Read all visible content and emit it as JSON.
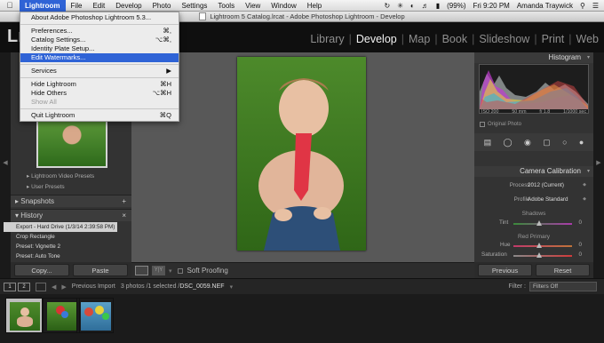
{
  "menubar": {
    "apple": "",
    "items": [
      "Lightroom",
      "File",
      "Edit",
      "Develop",
      "Photo",
      "Settings",
      "Tools",
      "View",
      "Window",
      "Help"
    ],
    "status": {
      "battery": "(99%)",
      "clock": "Fri 9:20 PM",
      "user": "Amanda Traywick"
    }
  },
  "window": {
    "title": "Lightroom 5 Catalog.lrcat - Adobe Photoshop Lightroom - Develop"
  },
  "app": {
    "logo": "Lr",
    "modules": [
      "Library",
      "Develop",
      "Map",
      "Book",
      "Slideshow",
      "Print",
      "Web"
    ],
    "active_module": "Develop"
  },
  "dropdown": {
    "items": [
      {
        "label": "About Adobe Photoshop Lightroom 5.3...",
        "shortcut": ""
      },
      {
        "sep": true
      },
      {
        "label": "Preferences...",
        "shortcut": "⌘,"
      },
      {
        "label": "Catalog Settings...",
        "shortcut": "⌥⌘,"
      },
      {
        "label": "Identity Plate Setup...",
        "shortcut": ""
      },
      {
        "label": "Edit Watermarks...",
        "shortcut": "",
        "highlighted": true
      },
      {
        "sep": true
      },
      {
        "label": "Services",
        "shortcut": "▶"
      },
      {
        "sep": true
      },
      {
        "label": "Hide Lightroom",
        "shortcut": "⌘H"
      },
      {
        "label": "Hide Others",
        "shortcut": "⌥⌘H"
      },
      {
        "label": "Show All",
        "shortcut": "",
        "disabled": true
      },
      {
        "sep": true
      },
      {
        "label": "Quit Lightroom",
        "shortcut": "⌘Q"
      }
    ]
  },
  "left_panel": {
    "presets": [
      "Lightroom Video Presets",
      "User Presets"
    ],
    "snapshots_label": "Snapshots",
    "snapshots_action": "+",
    "history_label": "History",
    "history_action": "×",
    "history": [
      "Export - Hard Drive (1/3/14 2:39:58 PM)",
      "Crop Rectangle",
      "Preset: Vignette 2",
      "Preset: Auto Tone"
    ],
    "copy_button": "Copy...",
    "paste_button": "Paste"
  },
  "toolbar": {
    "soft_proofing": "Soft Proofing"
  },
  "right_panel": {
    "histogram_label": "Histogram",
    "exif": [
      "ISO 200",
      "50 mm",
      "f/ 1.8",
      "1/1000 sec"
    ],
    "original_photo": "Original Photo",
    "camera_calibration_label": "Camera Calibration",
    "process_label": "Process :",
    "process_value": "2012 (Current)",
    "profile_label": "Profile :",
    "profile_value": "Adobe Standard",
    "shadows_label": "Shadows",
    "tint_label": "Tint",
    "tint_value": "0",
    "red_primary_label": "Red Primary",
    "hue_label": "Hue",
    "hue_value": "0",
    "saturation_label": "Saturation",
    "saturation_value": "0",
    "previous_button": "Previous",
    "reset_button": "Reset"
  },
  "filmstrip": {
    "box1": "1",
    "box2": "2",
    "source": "Previous Import",
    "count": "3 photos /1 selected /",
    "file": "DSC_0059.NEF",
    "filter_label": "Filter :",
    "filter_value": "Filters Off"
  }
}
